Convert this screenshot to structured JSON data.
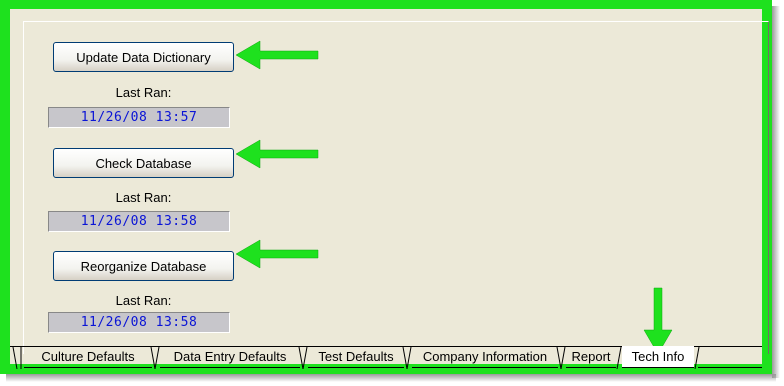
{
  "actions": [
    {
      "button": "Update Data Dictionary",
      "last_ran_label": "Last Ran:",
      "last_ran_value": "11/26/08  13:57"
    },
    {
      "button": "Check Database",
      "last_ran_label": "Last Ran:",
      "last_ran_value": "11/26/08  13:58"
    },
    {
      "button": "Reorganize Database",
      "last_ran_label": "Last Ran:",
      "last_ran_value": "11/26/08  13:58"
    }
  ],
  "tabs": [
    {
      "label": "Culture Defaults",
      "active": false
    },
    {
      "label": "Data Entry Defaults",
      "active": false
    },
    {
      "label": "Test Defaults",
      "active": false
    },
    {
      "label": "Company Information",
      "active": false
    },
    {
      "label": "Report",
      "active": false
    },
    {
      "label": "Tech Info",
      "active": true
    }
  ],
  "colors": {
    "highlight_border": "#1ee11e",
    "arrow": "#1ee11e",
    "panel_bg": "#ece9d8",
    "value_text": "#0a14d6",
    "value_bg": "#c7c6cb"
  },
  "icons": [
    "arrow-left-icon",
    "arrow-down-icon"
  ]
}
